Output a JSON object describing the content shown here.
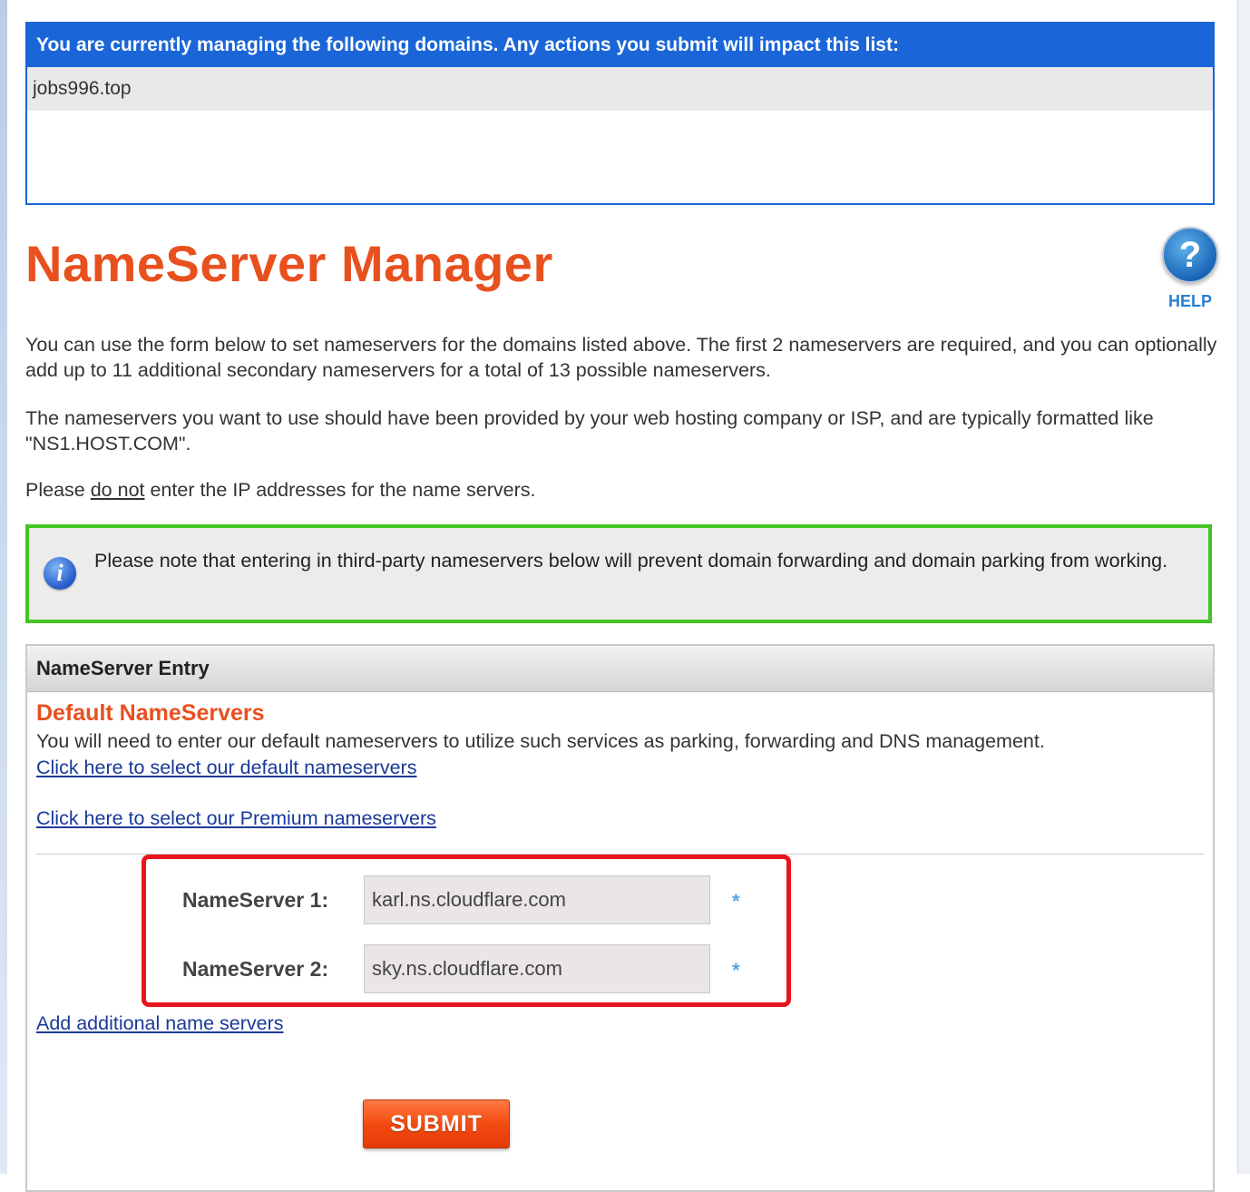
{
  "domains": {
    "header": "You are currently managing the following domains. Any actions you submit will impact this list:",
    "items": [
      "jobs996.top"
    ]
  },
  "page": {
    "title": "NameServer Manager",
    "help_label": "HELP",
    "help_glyph": "?",
    "para1": "You can use the form below to set nameservers for the domains listed above. The first 2 nameservers are required, and you can optionally add up to 11 additional secondary nameservers for a total of 13 possible nameservers.",
    "para2": "The nameservers you want to use should have been provided by your web hosting company or ISP, and are typically formatted like \"NS1.HOST.COM\".",
    "para3_prefix": "Please ",
    "para3_emph": "do not",
    "para3_suffix": " enter the IP addresses for the name servers."
  },
  "note": {
    "icon_glyph": "i",
    "text": "Please note that entering in third-party nameservers below will prevent domain forwarding and domain parking from working."
  },
  "entry": {
    "header": "NameServer Entry",
    "section_title": "Default NameServers",
    "section_desc": "You will need to enter our default nameservers to utilize such services as parking, forwarding and DNS management.",
    "link_default": "Click here to select our default nameservers",
    "link_premium": "Click here to select our Premium nameservers",
    "nameservers": [
      {
        "label": "NameServer 1:",
        "value": "karl.ns.cloudflare.com"
      },
      {
        "label": "NameServer 2:",
        "value": "sky.ns.cloudflare.com"
      }
    ],
    "required_glyph": "*",
    "add_link": "Add additional name servers",
    "submit_label": "SUBMIT"
  },
  "colors": {
    "accent_orange": "#e8501e",
    "header_blue": "#1a66d8",
    "note_green": "#44c424",
    "highlight_red": "#e8141c",
    "link_blue": "#1a3a9a"
  }
}
